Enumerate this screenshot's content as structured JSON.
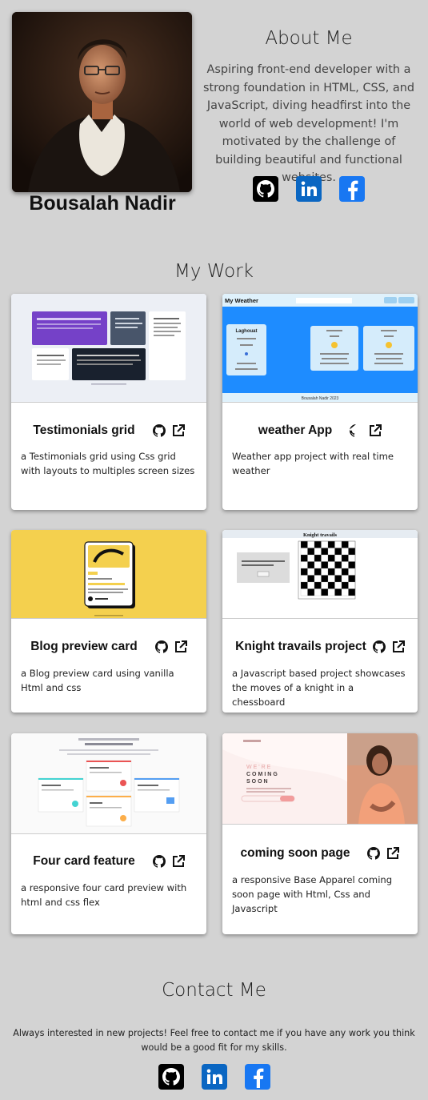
{
  "about": {
    "name": "Bousalah Nadir",
    "title": "About Me",
    "text": "Aspiring front-end developer with a strong foundation in HTML, CSS, and JavaScript, diving headfirst into the world of web development! I'm motivated by the challenge of building beautiful and functional websites.",
    "social": [
      "github-icon",
      "linkedin-icon",
      "facebook-icon"
    ]
  },
  "work": {
    "title": "My Work",
    "projects": [
      {
        "title": "Testimonials grid",
        "description": "a Testimonials grid using Css grid with layouts to multiples screen sizes"
      },
      {
        "title": "weather App",
        "description": "Weather app project with real time weather",
        "thumb": {
          "app_name": "My Weather",
          "city": "Laghouat",
          "footer": "Bousalah Nadir 2023"
        }
      },
      {
        "title": "Blog preview card",
        "description": "a Blog preview card using vanilla Html and css"
      },
      {
        "title": "Knight travails project",
        "description": "a Javascript based project showcases the moves of a knight in a chessboard",
        "thumb": {
          "heading": "Knight travails"
        }
      },
      {
        "title": "Four card feature",
        "description": "a responsive four card preview with html and css flex"
      },
      {
        "title": "coming soon page",
        "description": "a responsive Base Apparel coming soon page with Html, Css and Javascript",
        "thumb": {
          "line1": "WE'RE",
          "line2": "COMING",
          "line3": "SOON"
        }
      }
    ]
  },
  "contact": {
    "title": "Contact Me",
    "text": "Always interested in new projects! Feel free to contact me if you have any work you think would be a good fit for my skills."
  },
  "colors": {
    "background": "#d3d3d3",
    "github": "#000000",
    "linkedin": "#0a66c2",
    "facebook": "#1877f2"
  }
}
